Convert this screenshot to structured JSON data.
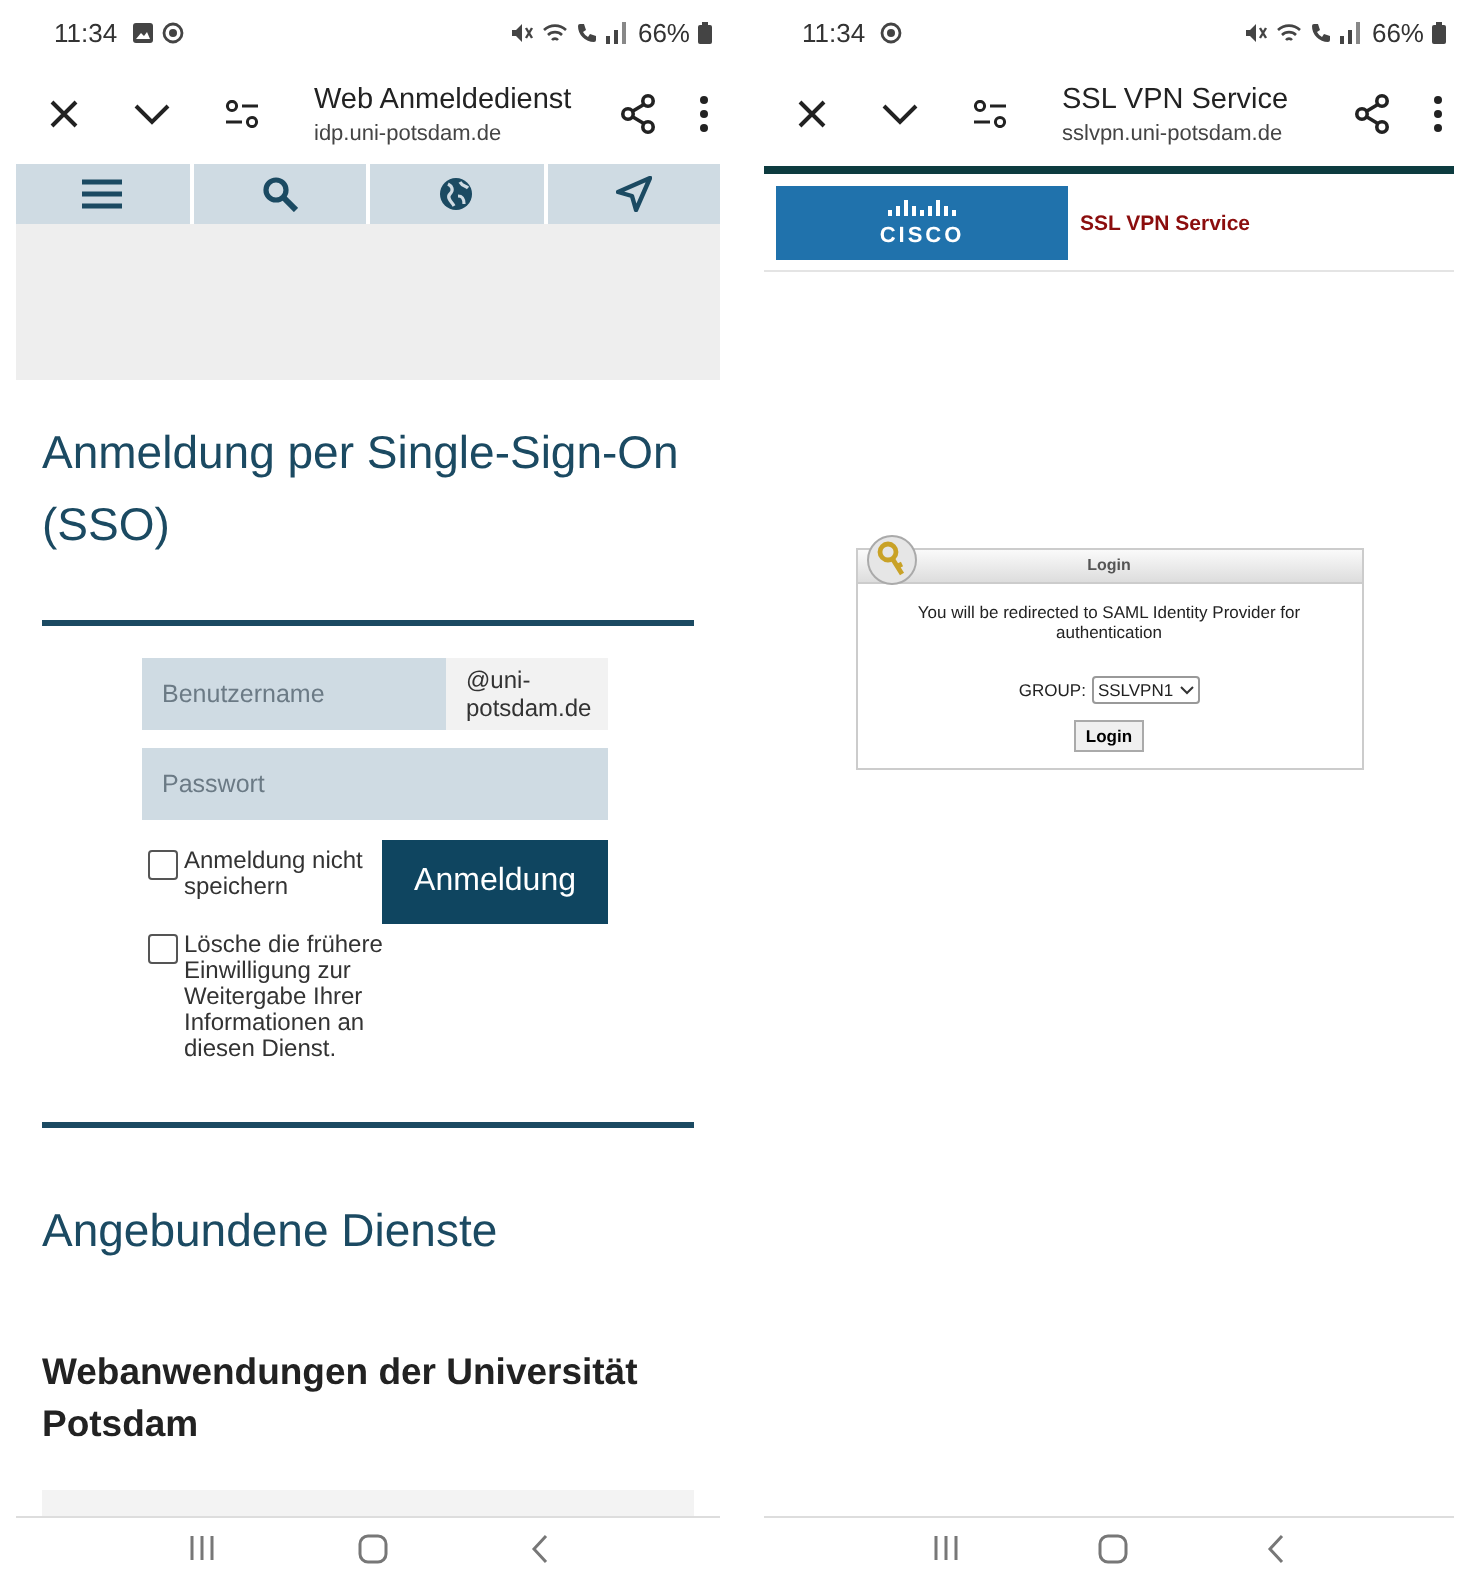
{
  "left_phone": {
    "status_bar": {
      "time": "11:34",
      "notifications": [
        {
          "kind": "gallery"
        },
        {
          "kind": "record"
        }
      ],
      "battery": "66%"
    },
    "toolbar": {
      "title": "Web Anmeldedienst",
      "url": "idp.uni-potsdam.de"
    },
    "nav_tabs": [
      {
        "kind": "menu"
      },
      {
        "kind": "search"
      },
      {
        "kind": "globe"
      },
      {
        "kind": "location"
      }
    ],
    "heading": "Anmeldung per Single-Sign-On (SSO)",
    "form": {
      "username": {
        "placeholder": "Benutzername"
      },
      "domain": "@uni-potsdam.de",
      "password": {
        "placeholder": "Passwort"
      },
      "checkboxes": [
        {
          "label": "Anmeldung nicht speichern",
          "checked": false
        },
        {
          "label": "Lösche die frühere Einwilligung zur Weitergabe Ihrer Informationen an diesen Dienst.",
          "checked": false
        }
      ],
      "submit": "Anmeldung"
    },
    "services_heading": "Angebundene Dienste",
    "services_subheading": "Webanwendungen der Universität Potsdam"
  },
  "right_phone": {
    "status_bar": {
      "time": "11:34",
      "notifications": [
        {
          "kind": "record"
        }
      ],
      "battery": "66%"
    },
    "toolbar": {
      "title": "SSL VPN Service",
      "url": "sslvpn.uni-potsdam.de"
    },
    "logo_text": "CISCO",
    "header_title": "SSL VPN Service",
    "login_dialog": {
      "title": "Login",
      "message": "You will be redirected to SAML Identity Provider for authentication",
      "group_label": "GROUP:",
      "group_value": "SSLVPN1",
      "button": "Login"
    }
  }
}
